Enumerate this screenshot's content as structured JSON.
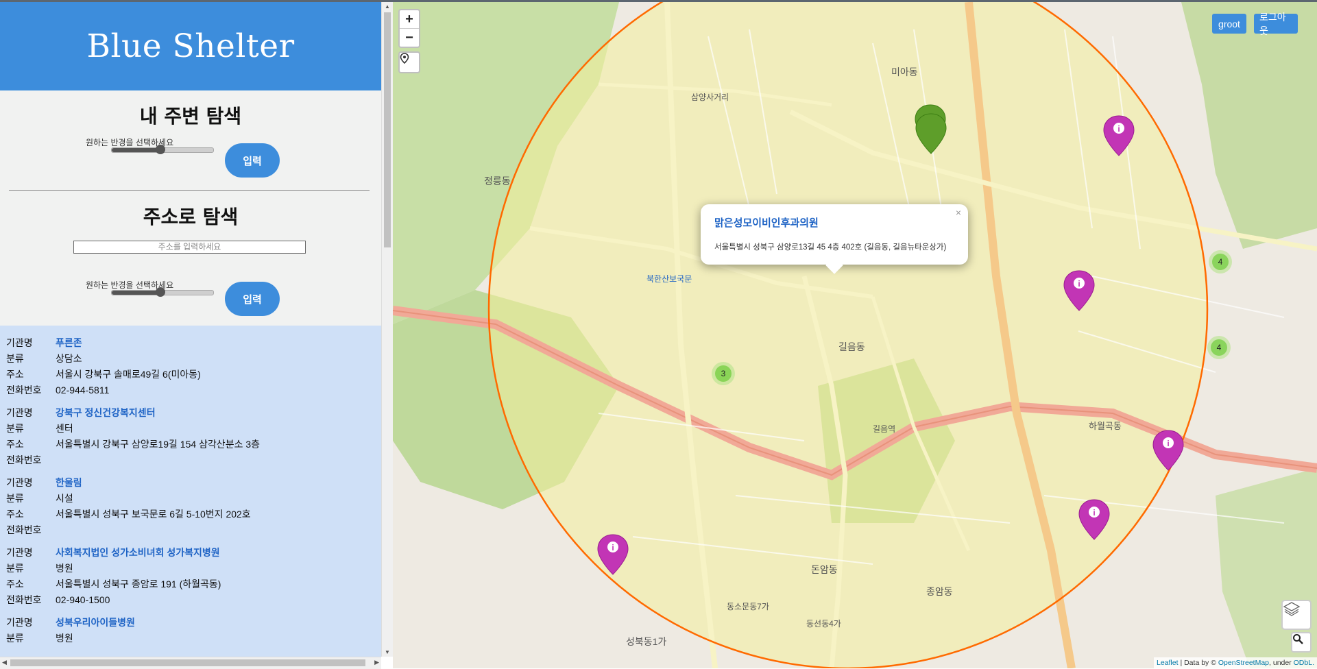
{
  "app": {
    "title": "Blue Shelter"
  },
  "nearby": {
    "heading": "내 주변 탐색",
    "radius_label": "원하는 반경을 선택하세요",
    "radius_value": 0.5,
    "submit": "입력"
  },
  "address_search": {
    "heading": "주소로 탐색",
    "placeholder": "주소를 입력하세요",
    "radius_label": "원하는 반경을 선택하세요",
    "radius_value": 0.5,
    "submit": "입력"
  },
  "labels": {
    "name": "기관명",
    "category": "분류",
    "address": "주소",
    "phone": "전화번호"
  },
  "results": [
    {
      "name": "푸른존",
      "category": "상담소",
      "address": "서울시 강북구 솔매로49길 6(미아동)",
      "phone": "02-944-5811"
    },
    {
      "name": "강북구 정신건강복지센터",
      "category": "센터",
      "address": "서울특별시 강북구 삼양로19길 154 삼각산분소 3층",
      "phone": ""
    },
    {
      "name": "한울림",
      "category": "시설",
      "address": "서울특별시 성북구 보국문로 6길 5-10번지 202호",
      "phone": ""
    },
    {
      "name": "사회복지법인 성가소비녀회 성가복지병원",
      "category": "병원",
      "address": "서울특별시 성북구 종암로 191 (하월곡동)",
      "phone": "02-940-1500"
    },
    {
      "name": "성북우리아이들병원",
      "category": "병원",
      "address": "",
      "phone": ""
    }
  ],
  "map": {
    "zoom_in": "+",
    "zoom_out": "−",
    "user_name": "groot",
    "logout": "로그아웃",
    "popup": {
      "title": "맑은성모이비인후과의원",
      "address": "서울특별시 성북구 삼양로13길 45 4층 402호 (길음동, 길음뉴타운상가)",
      "close": "×"
    },
    "clusters": [
      "3",
      "4",
      "4"
    ],
    "attribution": {
      "leaflet": "Leaflet",
      "data_by": "| Data by ©",
      "osm": "OpenStreetMap",
      "under": ", under",
      "odbl": "ODbL."
    },
    "place_labels": [
      "길음동",
      "돈암동",
      "정릉동",
      "미아동",
      "삼양사거리",
      "종암동",
      "성북동1가",
      "동소문동7가",
      "동선동4가",
      "하월곡동",
      "길음역",
      "북한산보국문"
    ],
    "colors": {
      "radius_circle": "#ff6a00",
      "marker_primary": "#c235b5",
      "marker_secondary": "#5e9e2a",
      "accent": "#3d8ddc"
    }
  }
}
